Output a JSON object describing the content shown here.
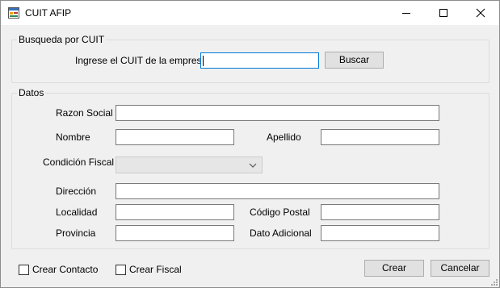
{
  "window": {
    "title": "CUIT AFIP",
    "icon": "app-form-icon"
  },
  "busqueda": {
    "group_label": "Busqueda por CUIT",
    "cuit_label": "Ingrese el CUIT de la empresa",
    "cuit_value": "",
    "search_button": "Buscar"
  },
  "datos": {
    "group_label": "Datos",
    "razon_social_label": "Razon Social",
    "razon_social_value": "",
    "nombre_label": "Nombre",
    "nombre_value": "",
    "apellido_label": "Apellido",
    "apellido_value": "",
    "condicion_fiscal_label": "Condición Fiscal",
    "condicion_fiscal_value": "",
    "direccion_label": "Dirección",
    "direccion_value": "",
    "localidad_label": "Localidad",
    "localidad_value": "",
    "codigo_postal_label": "Código Postal",
    "codigo_postal_value": "",
    "provincia_label": "Provincia",
    "provincia_value": "",
    "dato_adicional_label": "Dato Adicional",
    "dato_adicional_value": ""
  },
  "footer": {
    "crear_contacto_label": "Crear Contacto",
    "crear_contacto_checked": false,
    "crear_fiscal_label": "Crear Fiscal",
    "crear_fiscal_checked": false,
    "crear_button": "Crear",
    "cancelar_button": "Cancelar"
  },
  "colors": {
    "focus_border": "#0078d7",
    "window_bg": "#f0f0f0",
    "titlebar_bg": "#ffffff"
  }
}
